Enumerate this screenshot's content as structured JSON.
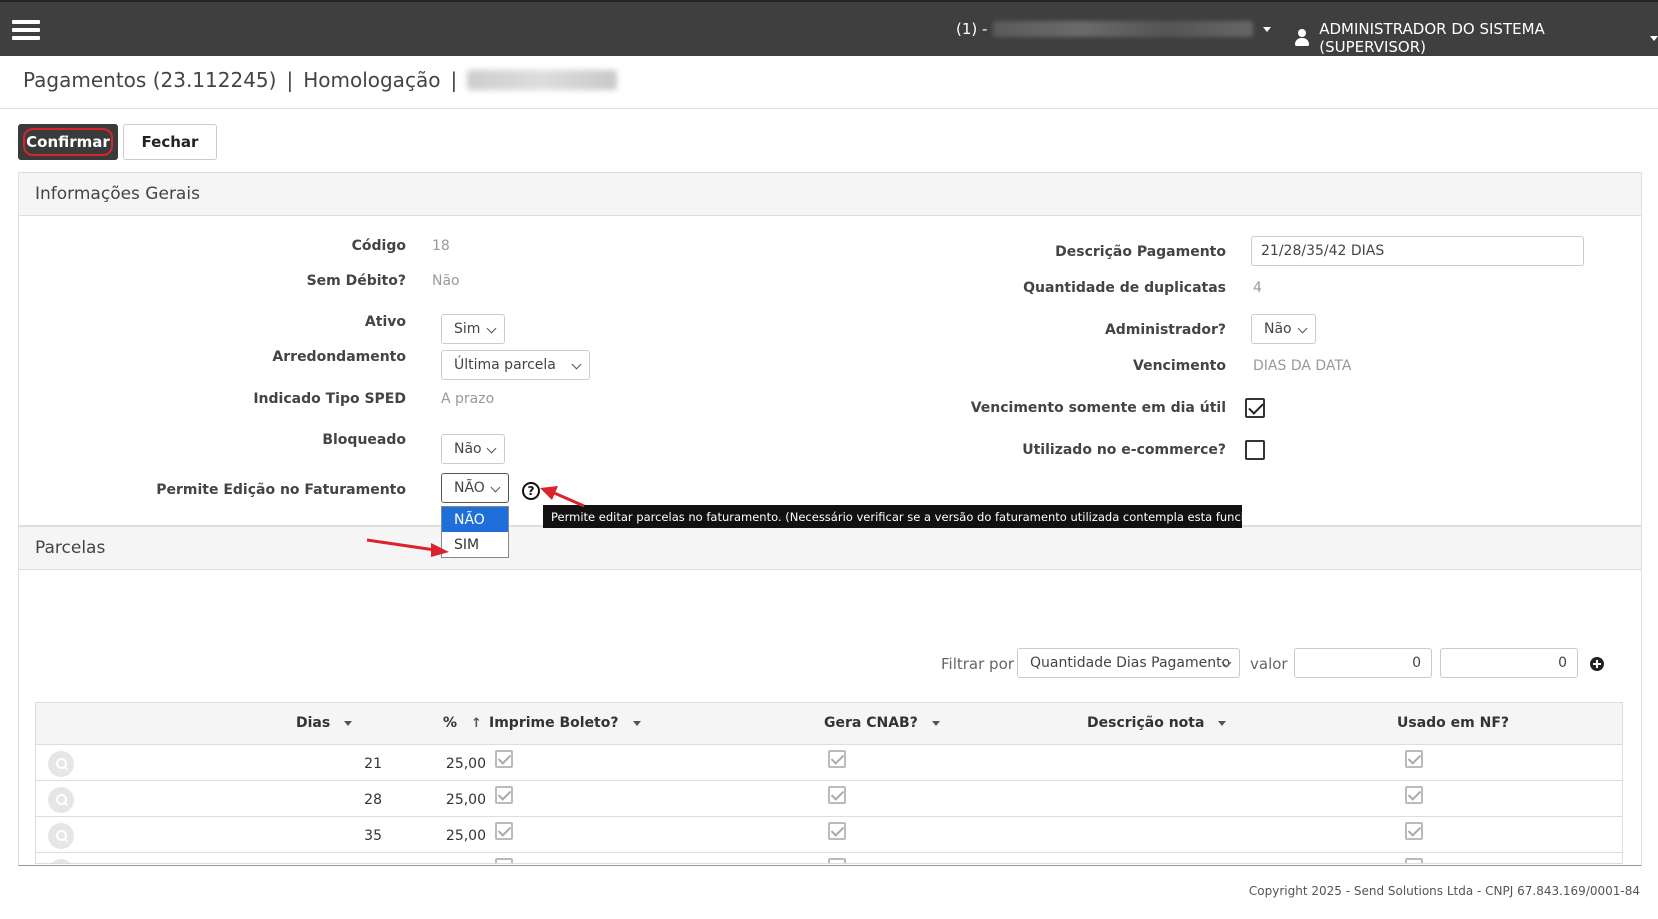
{
  "topbar": {
    "company_prefix": "(1) -",
    "user_name": "ADMINISTRADOR DO SISTEMA (SUPERVISOR)"
  },
  "page": {
    "title": "Pagamentos (23.112245)",
    "separator": "|",
    "environment": "Homologação"
  },
  "toolbar": {
    "confirm_label": "Confirmar",
    "close_label": "Fechar"
  },
  "gerais": {
    "title": "Informações Gerais",
    "codigo_label": "Código",
    "codigo_value": "18",
    "sem_debito_label": "Sem Débito?",
    "sem_debito_value": "Não",
    "ativo_label": "Ativo",
    "ativo_value": "Sim",
    "arredondamento_label": "Arredondamento",
    "arredondamento_value": "Última parcela",
    "sped_label": "Indicado Tipo SPED",
    "sped_value": "A prazo",
    "bloqueado_label": "Bloqueado",
    "bloqueado_value": "Não",
    "permite_label": "Permite Edição no Faturamento",
    "permite_value": "NÃO",
    "permite_options": [
      "NÃO",
      "SIM"
    ],
    "descricao_label": "Descrição Pagamento",
    "descricao_value": "21/28/35/42 DIAS",
    "qtd_label": "Quantidade de duplicatas",
    "qtd_value": "4",
    "admin_label": "Administrador?",
    "admin_value": "Não",
    "vencimento_label": "Vencimento",
    "vencimento_value": "DIAS DA DATA",
    "dia_util_label": "Vencimento somente em dia útil",
    "ecommerce_label": "Utilizado no e-commerce?",
    "tooltip": "Permite editar parcelas no faturamento. (Necessário verificar se a versão do faturamento utilizada contempla esta funcionalidade)"
  },
  "parcelas": {
    "title": "Parcelas",
    "filter_label": "Filtrar por",
    "filter_value": "Quantidade Dias Pagamento",
    "valor_label": "valor",
    "valor_from": "0",
    "valor_to": "0",
    "columns": [
      "Dias",
      "%",
      "Imprime Boleto?",
      "Gera CNAB?",
      "Descrição nota",
      "Usado em NF?"
    ],
    "rows": [
      {
        "dias": "21",
        "pct": "25,00"
      },
      {
        "dias": "28",
        "pct": "25,00"
      },
      {
        "dias": "35",
        "pct": "25,00"
      }
    ]
  },
  "footer": {
    "copyright": "Copyright 2025 - Send Solutions Ltda - CNPJ 67.843.169/0001-84"
  },
  "colors": {
    "topbar": "#3f3f3f",
    "accent_red": "#d9232d",
    "selected_option": "#1e6fd9"
  }
}
